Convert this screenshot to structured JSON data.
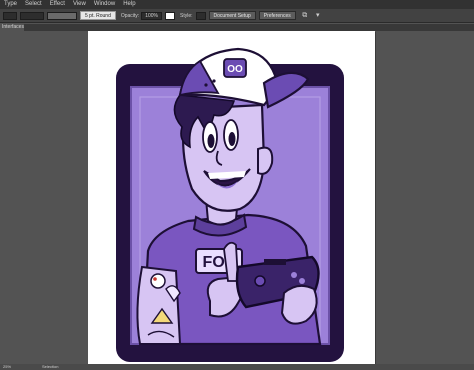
{
  "menu": {
    "items": [
      "Type",
      "Select",
      "Effect",
      "View",
      "Window",
      "Help"
    ]
  },
  "controlbar": {
    "brush_label": "5 pt. Round",
    "opacity_label": "Opacity:",
    "opacity_value": "100%",
    "style_label": "Style:",
    "doc_setup_label": "Document Setup",
    "preferences_label": "Preferences",
    "fill_color": "#8a6fd0",
    "stroke_color": "#e8e8e8"
  },
  "tab": {
    "label": "Interfaces"
  },
  "artwork": {
    "cap_logo_text": "OO",
    "shirt_text": "FOP",
    "frame_color": "#23123f",
    "panel_color": "#9c81d9",
    "skin_color": "#d7c5f3",
    "shirt_color": "#7a56c0",
    "cap_color": "#6b4cb3",
    "hair_color": "#2d1a50"
  },
  "status": {
    "zoom": "25%",
    "tool": "Selection"
  }
}
